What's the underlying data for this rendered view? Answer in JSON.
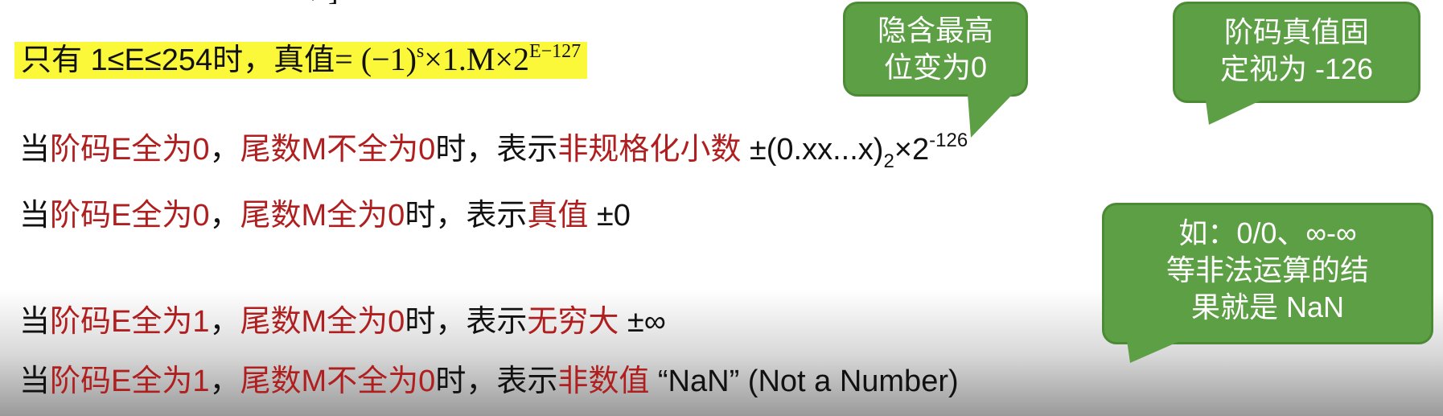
{
  "top_fragment": "/ ]",
  "line1": {
    "prefix": "只有 1≤E≤254时，真值",
    "formula_main": "= (−1)",
    "formula_s": "s",
    "formula_rest": "×1.M×2",
    "formula_exp": "E−127"
  },
  "line2": {
    "p1": "当",
    "p2": "阶码E全为0",
    "p3": "，",
    "p4": "尾数M不全为0",
    "p5": "时，表示",
    "p6": "非规格化小数",
    "formula": " ±(0.xx...x)",
    "formula_sub": "2",
    "formula_times": "×2",
    "formula_exp": "-126"
  },
  "line3": {
    "p1": "当",
    "p2": "阶码E全为0",
    "p3": "，",
    "p4": "尾数M全为0",
    "p5": "时，表示",
    "p6": "真值",
    "p7": " ±0"
  },
  "line4": {
    "p1": "当",
    "p2": "阶码E全为1",
    "p3": "，",
    "p4": "尾数M全为0",
    "p5": "时，表示",
    "p6": "无穷大",
    "p7": " ±∞"
  },
  "line5": {
    "p1": "当",
    "p2": "阶码E全为1",
    "p3": "，",
    "p4": "尾数M不全为0",
    "p5": "时，表示",
    "p6": "非数值",
    "p7": " “NaN” (Not a Number)"
  },
  "bubbles": {
    "b1_line1": "隐含最高",
    "b1_line2": "位变为0",
    "b2_line1": "阶码真值固",
    "b2_line2": "定视为 -126",
    "b3_line1": "如：0/0、∞-∞",
    "b3_line2": "等非法运算的结",
    "b3_line3": "果就是 NaN"
  },
  "colors": {
    "highlight": "#fbf83a",
    "red_text": "#b01f1f",
    "bubble_fill": "#5d9f44"
  }
}
